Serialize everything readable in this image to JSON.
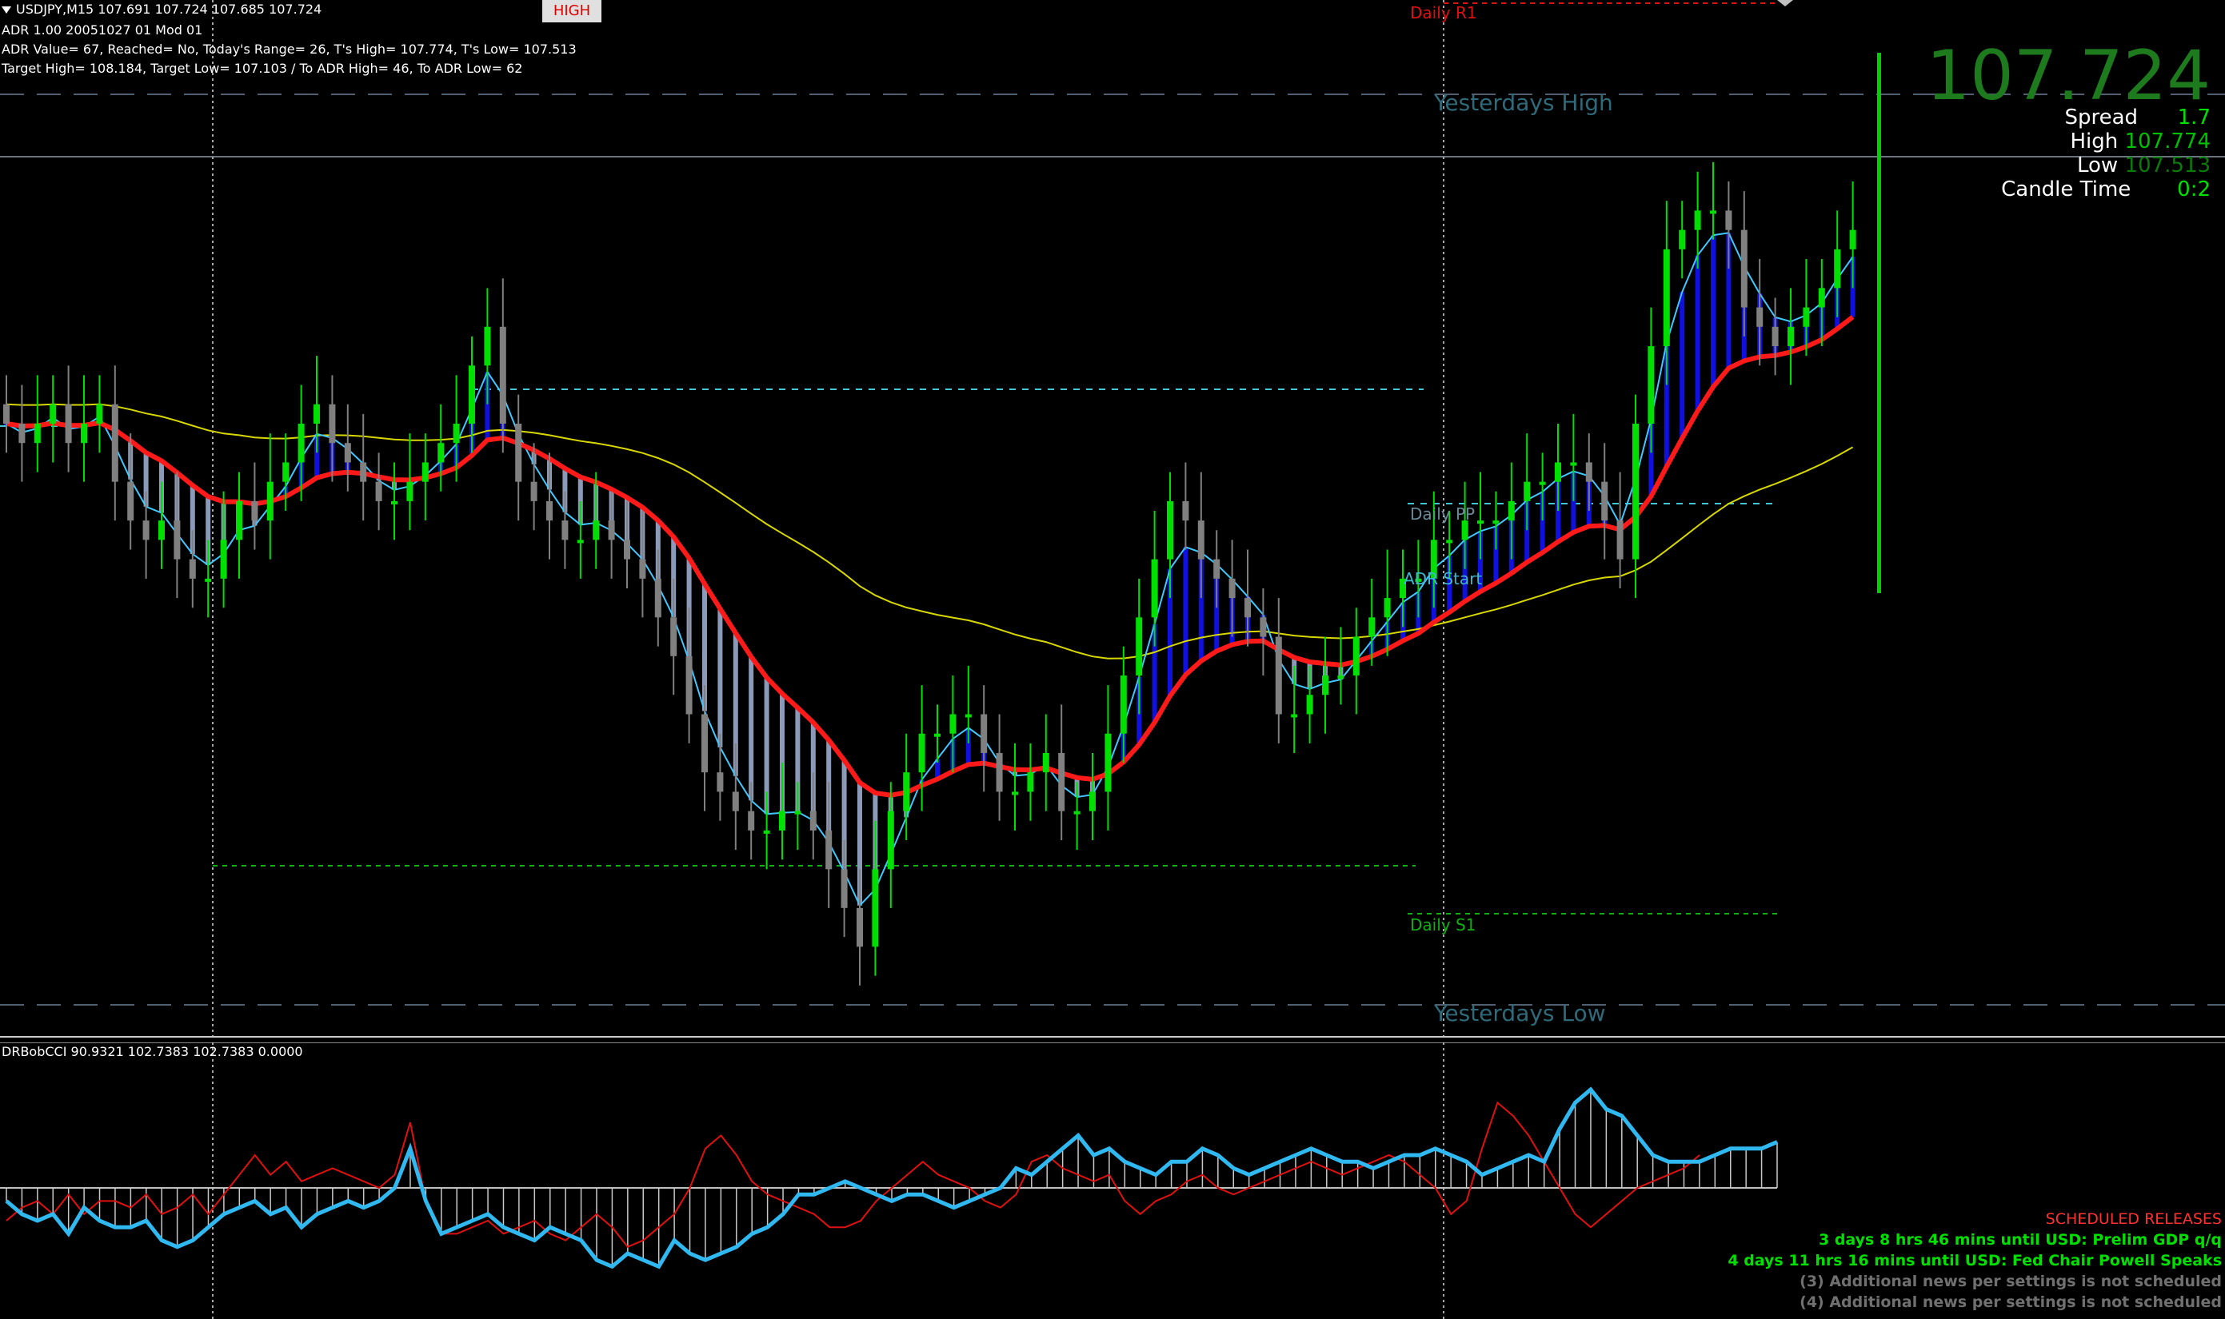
{
  "header": {
    "symbol_line": "USDJPY,M15  107.691 107.724 107.685 107.724",
    "adr_line": "ADR 1.00 20051027 01 Mod 01",
    "adr_value_line": "ADR Value= 67, Reached= No, Today's Range= 26, T's High= 107.774, T's Low= 107.513",
    "target_line": "Target High= 108.184, Target Low= 107.103 / To ADR High= 46, To ADR Low= 62",
    "badge": "HIGH"
  },
  "levels": {
    "daily_r1": "Daily R1",
    "yesterdays_high": "Yesterdays  High",
    "daily_pp": "Daily PP",
    "adr_start": "ADR Start",
    "daily_s1": "Daily S1",
    "yesterdays_low": "Yesterdays  Low"
  },
  "quote": {
    "price": "107.724",
    "spread_label": "Spread",
    "spread_value": "1.7",
    "high_label": "High",
    "high_value": "107.774",
    "low_label": "Low",
    "low_value": "107.513",
    "candle_label": "Candle Time",
    "candle_value": "0:2"
  },
  "indicator": {
    "name_line": "DRBobCCI 90.9321 102.7383 102.7383 0.0000"
  },
  "news": {
    "title": "SCHEDULED RELEASES",
    "item1": "3 days 8 hrs 46 mins until USD: Prelim GDP q/q",
    "item2": "4 days 11 hrs 16 mins until USD: Fed Chair Powell Speaks",
    "item3": "(3)  Additional news per settings is not scheduled",
    "item4": "(4)  Additional news per settings is not scheduled"
  },
  "colors": {
    "bull": "#00e000",
    "bear": "#808080",
    "red_ma": "#ff1a1a",
    "cyan": "#40c8ff",
    "yellow": "#d8d800",
    "fill_down": "#8a9ab8",
    "fill_up": "#1010e0"
  },
  "chart_data": {
    "type": "candlestick",
    "price_closes": [
      107.52,
      107.5,
      107.52,
      107.54,
      107.5,
      107.52,
      107.54,
      107.46,
      107.42,
      107.4,
      107.42,
      107.38,
      107.36,
      107.36,
      107.4,
      107.44,
      107.42,
      107.46,
      107.48,
      107.52,
      107.54,
      107.5,
      107.48,
      107.46,
      107.44,
      107.44,
      107.46,
      107.48,
      107.5,
      107.52,
      107.58,
      107.62,
      107.52,
      107.46,
      107.44,
      107.42,
      107.4,
      107.4,
      107.42,
      107.4,
      107.38,
      107.36,
      107.32,
      107.28,
      107.22,
      107.16,
      107.14,
      107.12,
      107.1,
      107.1,
      107.12,
      107.12,
      107.1,
      107.06,
      107.02,
      106.98,
      107.06,
      107.12,
      107.16,
      107.2,
      107.2,
      107.22,
      107.22,
      107.18,
      107.14,
      107.14,
      107.16,
      107.18,
      107.12,
      107.12,
      107.14,
      107.2,
      107.26,
      107.32,
      107.38,
      107.44,
      107.42,
      107.38,
      107.36,
      107.34,
      107.32,
      107.3,
      107.22,
      107.22,
      107.24,
      107.26,
      107.26,
      107.3,
      107.32,
      107.34,
      107.36,
      107.36,
      107.4,
      107.4,
      107.42,
      107.42,
      107.42,
      107.44,
      107.46,
      107.46,
      107.48,
      107.48,
      107.46,
      107.42,
      107.38,
      107.52,
      107.6,
      107.7,
      107.72,
      107.74,
      107.74,
      107.72,
      107.64,
      107.62,
      107.6,
      107.62,
      107.64,
      107.66,
      107.7,
      107.72
    ],
    "cci_main": [
      -20,
      -40,
      -50,
      -40,
      -70,
      -30,
      -50,
      -60,
      -60,
      -50,
      -80,
      -90,
      -80,
      -60,
      -40,
      -30,
      -20,
      -40,
      -30,
      -60,
      -40,
      -30,
      -20,
      -30,
      -20,
      0,
      60,
      -20,
      -70,
      -60,
      -50,
      -40,
      -60,
      -70,
      -80,
      -60,
      -70,
      -80,
      -110,
      -120,
      -100,
      -110,
      -120,
      -80,
      -100,
      -110,
      -100,
      -90,
      -70,
      -60,
      -40,
      -10,
      -10,
      0,
      10,
      0,
      -10,
      -20,
      -10,
      -10,
      -20,
      -30,
      -20,
      -10,
      0,
      30,
      20,
      40,
      60,
      80,
      50,
      60,
      40,
      30,
      20,
      40,
      40,
      60,
      50,
      30,
      20,
      30,
      40,
      50,
      60,
      50,
      40,
      40,
      30,
      40,
      50,
      50,
      60,
      50,
      40,
      20,
      30,
      40,
      50,
      40,
      90,
      130,
      150,
      120,
      110,
      80,
      50,
      40,
      40,
      40,
      50,
      60,
      60,
      60,
      70
    ],
    "cci_signal": [
      -50,
      -30,
      -20,
      -40,
      -10,
      -40,
      -20,
      -20,
      -30,
      -10,
      -40,
      -30,
      -10,
      -40,
      -10,
      20,
      50,
      20,
      40,
      10,
      20,
      30,
      20,
      10,
      0,
      20,
      100,
      -20,
      -70,
      -70,
      -60,
      -50,
      -70,
      -60,
      -50,
      -70,
      -80,
      -60,
      -40,
      -60,
      -90,
      -80,
      -60,
      -40,
      0,
      60,
      80,
      50,
      10,
      -10,
      -20,
      -30,
      -40,
      -60,
      -60,
      -50,
      -20,
      0,
      20,
      40,
      20,
      10,
      0,
      -20,
      -30,
      -10,
      40,
      50,
      30,
      20,
      10,
      20,
      -20,
      -40,
      -20,
      -10,
      10,
      20,
      0,
      -10,
      0,
      10,
      20,
      30,
      40,
      30,
      20,
      30,
      40,
      50,
      40,
      20,
      0,
      -40,
      -20,
      60,
      130,
      110,
      80,
      40,
      0,
      -40,
      -60,
      -40,
      -20,
      0,
      10,
      20,
      30,
      50
    ],
    "ylabel": ""
  }
}
